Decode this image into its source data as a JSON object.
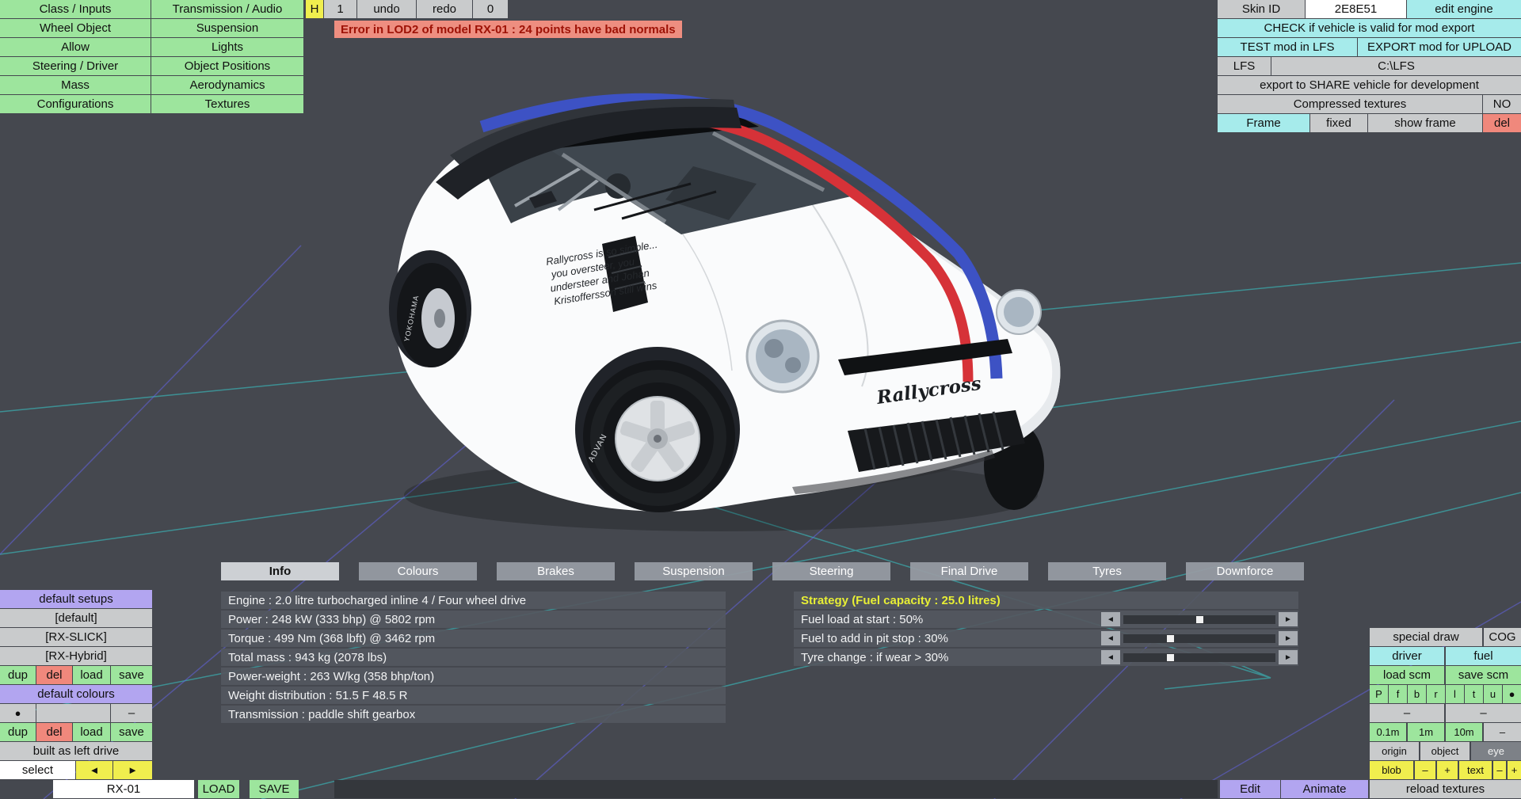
{
  "menu_left": {
    "col1": [
      "Class / Inputs",
      "Wheel Object",
      "Allow",
      "Steering / Driver",
      "Mass",
      "Configurations"
    ],
    "col2": [
      "Transmission / Audio",
      "Suspension",
      "Lights",
      "Object Positions",
      "Aerodynamics",
      "Textures"
    ]
  },
  "history_bar": {
    "h": "H",
    "count": "1",
    "undo": "undo",
    "redo": "redo",
    "zero": "0"
  },
  "error_message": "Error in LOD2 of model RX-01 : 24 points have bad normals",
  "export_panel": {
    "skin_id_label": "Skin ID",
    "skin_id_value": "2E8E51",
    "edit_engine": "edit engine",
    "check_row": "CHECK if vehicle is valid for mod export",
    "test_btn": "TEST mod in LFS",
    "export_btn": "EXPORT mod for UPLOAD",
    "lfs_btn": "LFS",
    "lfs_path": "C:\\LFS",
    "share_btn": "export to SHARE vehicle for development",
    "compressed_label": "Compressed textures",
    "compressed_value": "NO",
    "frame_btn": "Frame",
    "fixed_btn": "fixed",
    "show_frame_btn": "show frame",
    "del_btn": "del"
  },
  "tabs": [
    "Info",
    "Colours",
    "Brakes",
    "Suspension",
    "Steering",
    "Final Drive",
    "Tyres",
    "Downforce"
  ],
  "active_tab": "Info",
  "info_panel": {
    "rows": [
      "Engine : 2.0 litre turbocharged inline 4 / Four wheel drive",
      "Power : 248 kW (333 bhp) @ 5802 rpm",
      "Torque : 499 Nm (368 lbft) @ 3462 rpm",
      "Total mass : 943 kg (2078 lbs)",
      "Power-weight : 263 W/kg (358 bhp/ton)",
      "Weight distribution : 51.5 F  48.5 R",
      "Transmission : paddle shift gearbox"
    ]
  },
  "strategy_panel": {
    "title": "Strategy (Fuel capacity : 25.0 litres)",
    "arrows": {
      "left": "◄",
      "right": "►"
    },
    "sliders": [
      {
        "label": "Fuel load at start : 50%",
        "percent": 50
      },
      {
        "label": "Fuel to add in pit stop : 30%",
        "percent": 30
      },
      {
        "label": "Tyre change : if wear > 30%",
        "percent": 30
      }
    ]
  },
  "setups_panel": {
    "default_setups": "default setups",
    "items": [
      "[default]",
      "[RX-SLICK]",
      "[RX-Hybrid]"
    ],
    "dup": "dup",
    "del": "del",
    "load": "load",
    "save": "save",
    "default_colours": "default colours",
    "dot": "●",
    "minus": "–",
    "built": "built as left drive",
    "select": "select",
    "prev": "◄",
    "next": "►"
  },
  "model_bar": {
    "name": "RX-01",
    "load": "LOAD",
    "save": "SAVE"
  },
  "view_panel": {
    "special_draw": "special draw",
    "cog": "COG",
    "driver": "driver",
    "fuel": "fuel",
    "load_scm": "load scm",
    "save_scm": "save scm",
    "letters": [
      "P",
      "f",
      "b",
      "r",
      "l",
      "t",
      "u",
      "●"
    ],
    "minus": "–",
    "plus": "+",
    "scales": [
      "0.1m",
      "1m",
      "10m"
    ],
    "origin": "origin",
    "object": "object",
    "eye": "eye",
    "blob": "blob",
    "text": "text",
    "edit": "Edit",
    "animate": "Animate",
    "reload": "reload textures"
  },
  "car": {
    "door_text": [
      "Rallycross is so simple...",
      "you oversteer, you",
      "understeer and Johan",
      "Kristoffersson still wins"
    ],
    "front_text": "Rallycross",
    "tyre_text_front": "ADVAN",
    "tyre_text_rear": "YOKOHAMA"
  },
  "colors": {
    "accent_green": "#9de59d",
    "accent_cyan": "#a6ebeb",
    "accent_lavender": "#b2a5f0",
    "accent_yellow": "#f0ee4e",
    "accent_red": "#f0887c",
    "viewport_bg": "#45484f",
    "grid_cyan": "#36d8d8",
    "grid_blue": "#6565ee",
    "strategy_title": "#e7ee35"
  }
}
